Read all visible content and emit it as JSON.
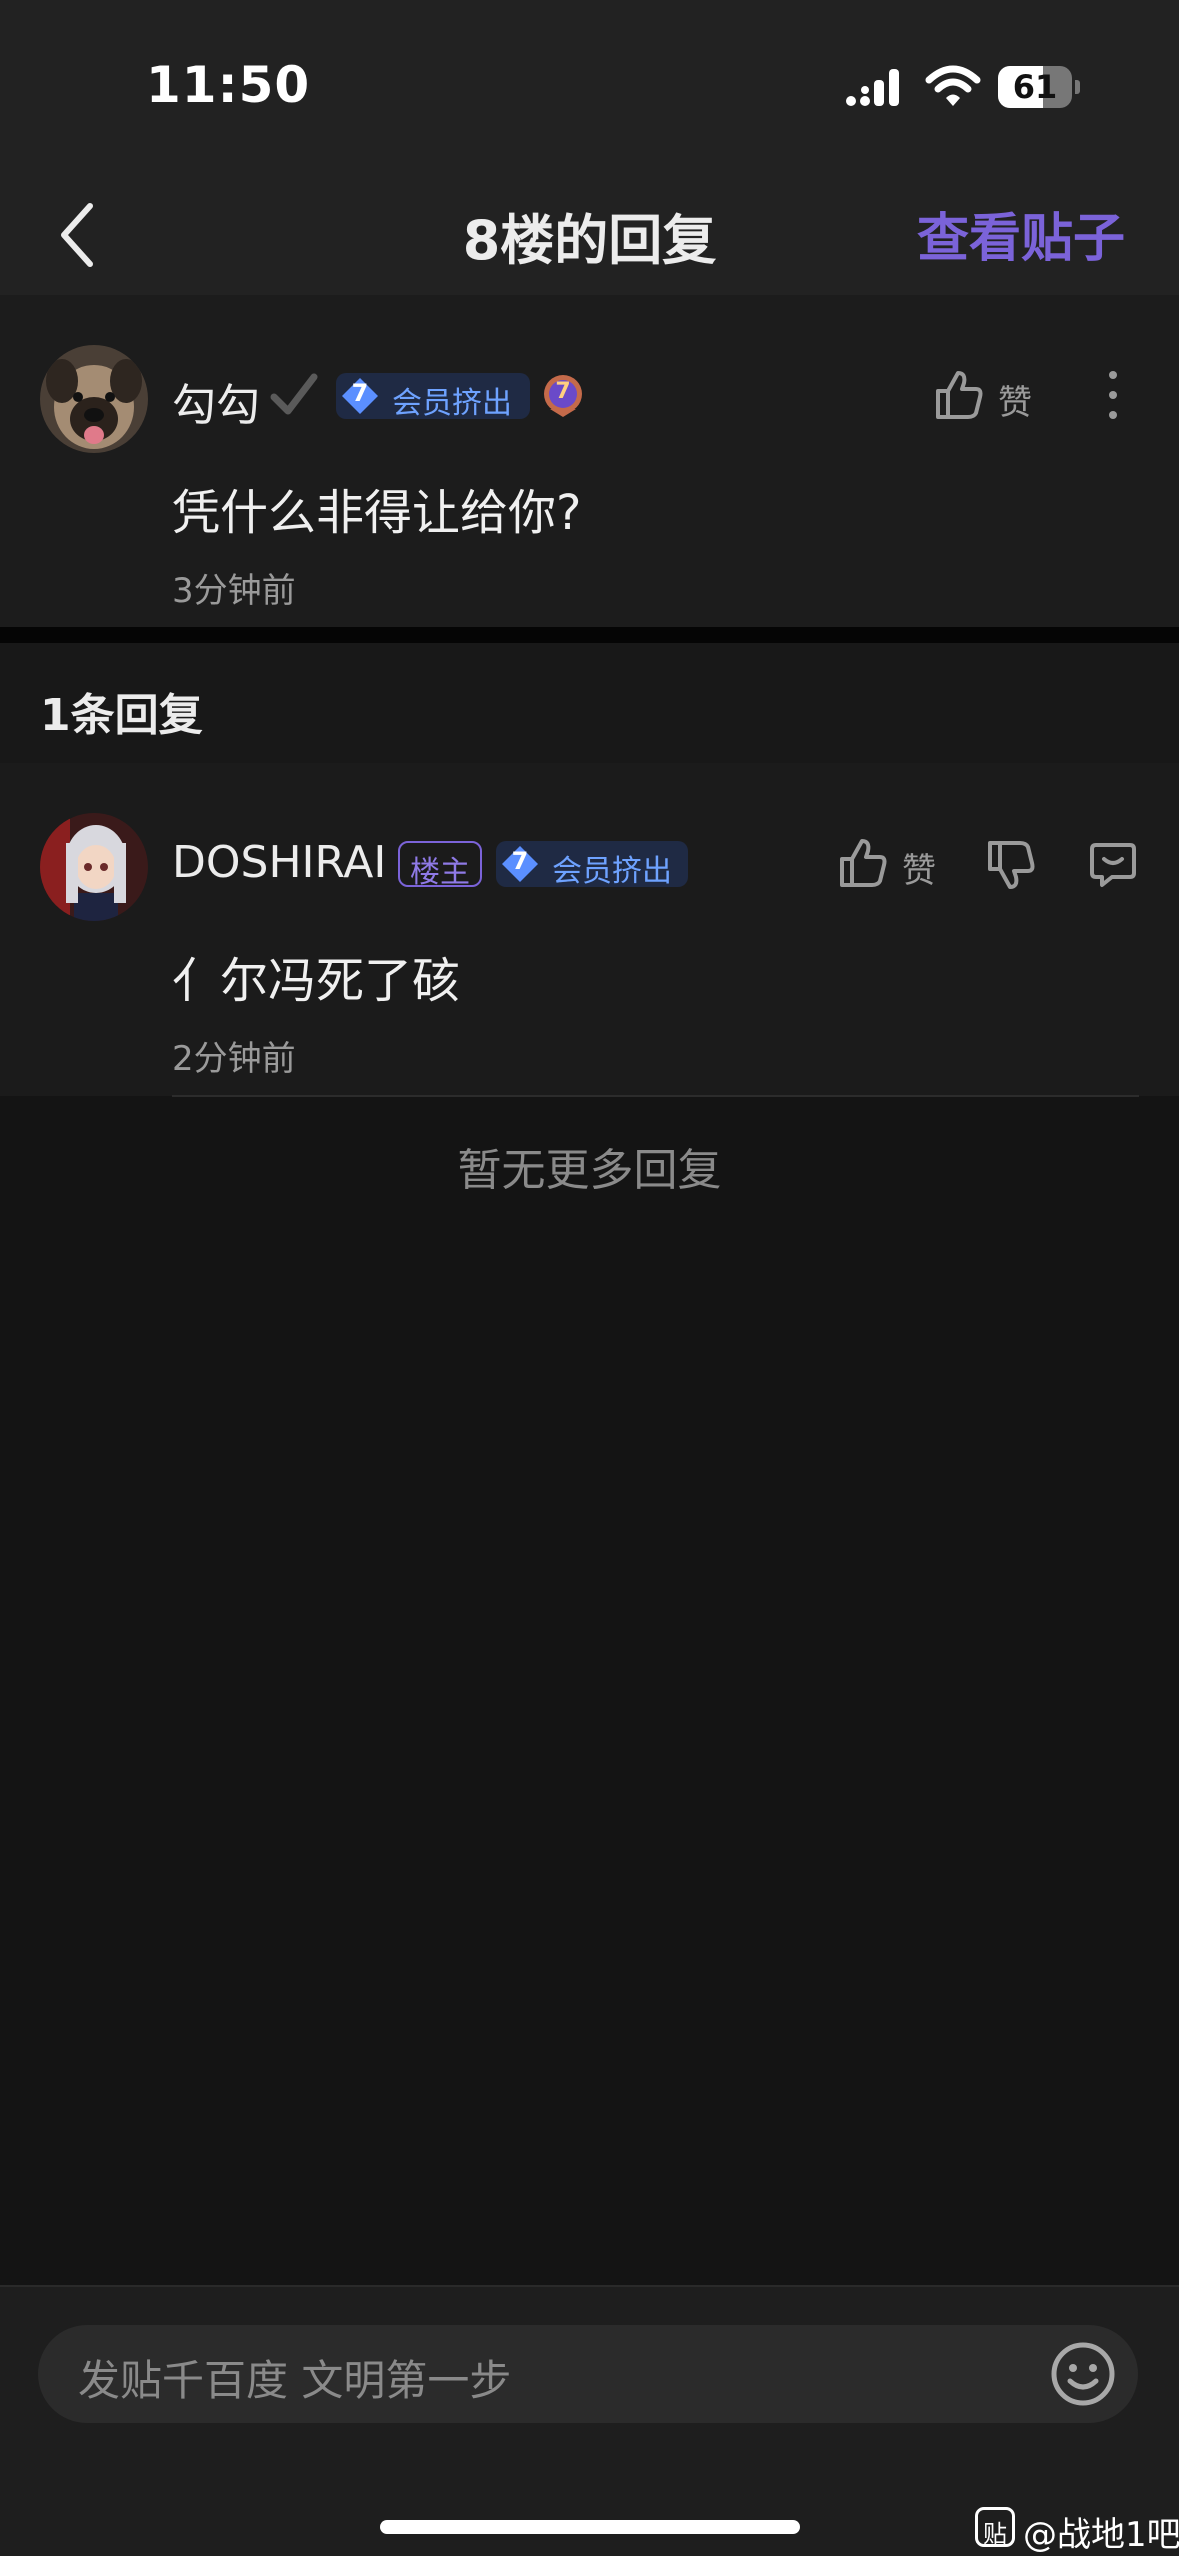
{
  "status_bar": {
    "time": "11:50",
    "battery": "61",
    "battery_level": 0.61
  },
  "nav": {
    "title": "8楼的回复",
    "view_post_label": "查看贴子"
  },
  "main_post": {
    "username": "勾勾",
    "member_level": "7",
    "member_badge": "会员挤出",
    "level_badge": "7",
    "like_label": "赞",
    "content": "凭什么非得让给你?",
    "time": "3分钟前"
  },
  "replies": {
    "count_label": "1条回复",
    "items": [
      {
        "username": "DOSHIRAI",
        "owner_badge": "楼主",
        "member_level": "7",
        "member_badge": "会员挤出",
        "like_label": "赞",
        "content": "亻尔冯死了硋",
        "time": "2分钟前"
      }
    ],
    "no_more": "暂无更多回复"
  },
  "input": {
    "placeholder": "发贴千百度 文明第一步"
  },
  "watermark": {
    "icon": "贴",
    "text": "@战地1吧"
  },
  "colors": {
    "accent": "#7b63d9",
    "member_blue": "#6ea2ff",
    "background": "#141414"
  }
}
